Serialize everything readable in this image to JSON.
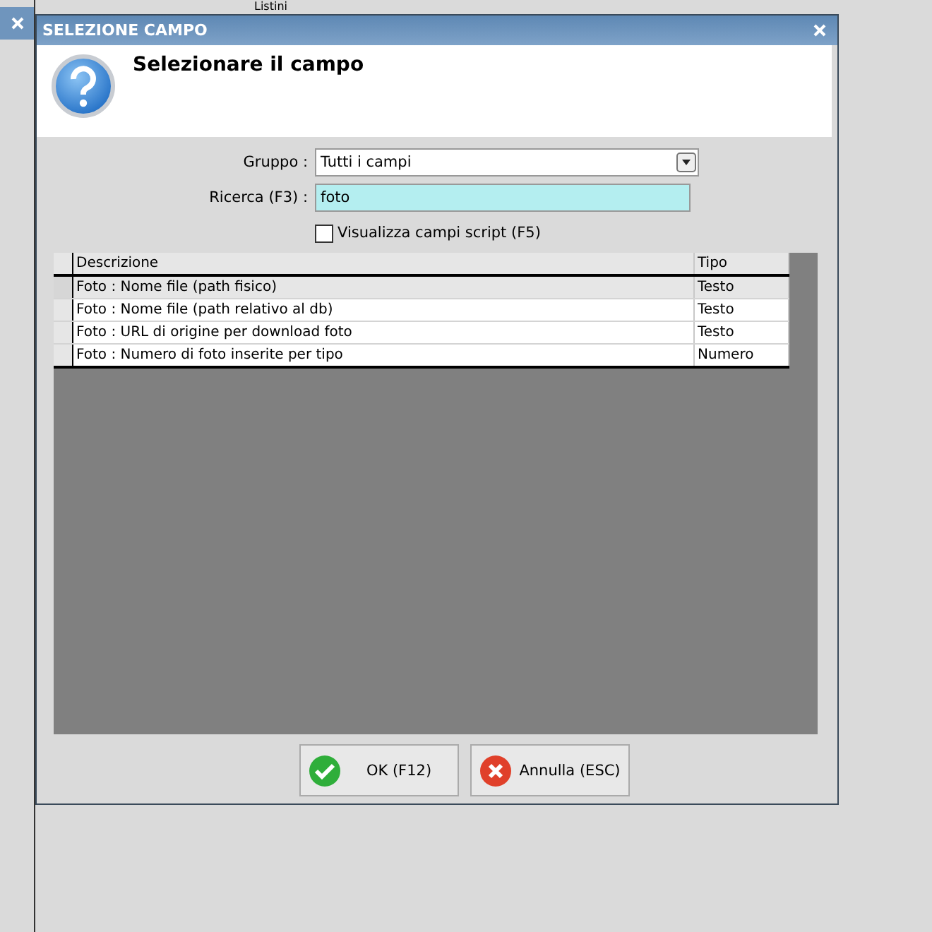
{
  "background": {
    "title": "Listini"
  },
  "window": {
    "title": "SELEZIONE CAMPO",
    "heading": "Selezionare il campo"
  },
  "form": {
    "group_label": "Gruppo :",
    "group_value": "Tutti i campi",
    "search_label": "Ricerca (F3) :",
    "search_value": "foto",
    "script_checkbox": {
      "label": "Visualizza campi script (F5)",
      "checked": false
    }
  },
  "table": {
    "columns": [
      "Descrizione",
      "Tipo"
    ],
    "rows": [
      {
        "cells": [
          "Foto : Nome file (path fisico)",
          "Testo"
        ],
        "selected": true
      },
      {
        "cells": [
          "Foto : Nome file (path relativo al db)",
          "Testo"
        ],
        "selected": false
      },
      {
        "cells": [
          "Foto : URL di origine per download foto",
          "Testo"
        ],
        "selected": false
      },
      {
        "cells": [
          "Foto : Numero di foto inserite per tipo",
          "Numero"
        ],
        "selected": false
      }
    ]
  },
  "buttons": [
    {
      "kind": "ok",
      "label": "OK (F12)"
    },
    {
      "kind": "cancel",
      "label": "Annulla (ESC)"
    }
  ]
}
